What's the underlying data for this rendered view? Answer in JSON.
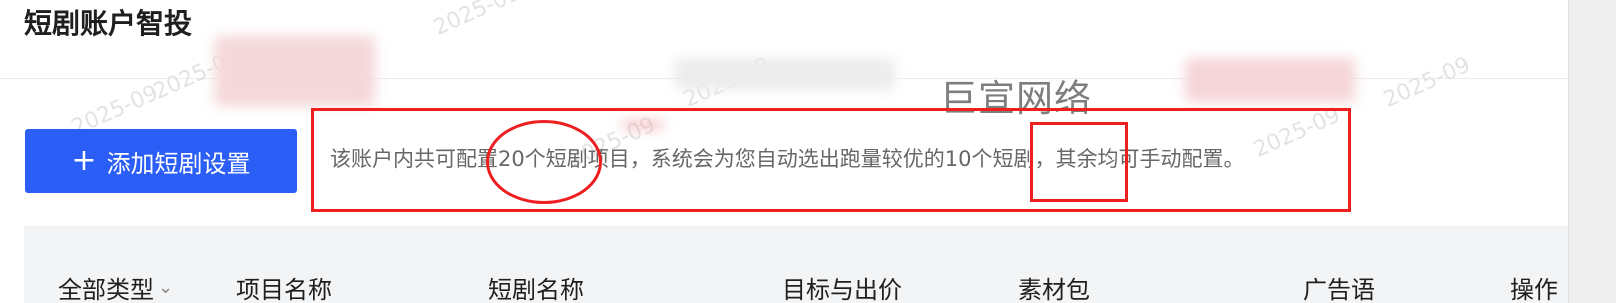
{
  "header": {
    "title": "短剧账户智投"
  },
  "watermark": {
    "company": "巨宣网络",
    "pattern_text": "2025-09"
  },
  "toolbar": {
    "add_button_icon": "plus-icon",
    "add_button_label": "添加短剧设置"
  },
  "notice": {
    "text": "该账户内共可配置20个短剧项目，系统会为您自动选出跑量较优的10个短剧，其余均可手动配置。"
  },
  "table": {
    "columns": [
      "全部类型",
      "项目名称",
      "短剧名称",
      "目标与出价",
      "素材包",
      "广告语",
      "操作"
    ]
  },
  "colors": {
    "primary": "#2b5ef6",
    "annotation_red": "#ee1f1f",
    "table_header_bg": "#f3f4f6"
  }
}
